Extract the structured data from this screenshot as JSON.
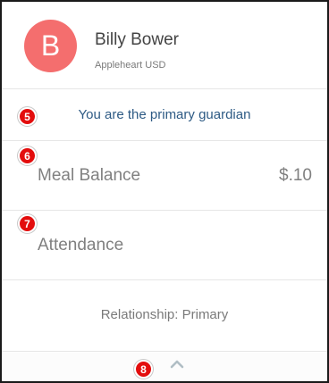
{
  "colors": {
    "avatar_bg": "#f46e6e",
    "marker_bg": "#e30d0d",
    "accent_text": "#2d5a84",
    "chevron": "#b0bec5"
  },
  "profile": {
    "avatar_letter": "B",
    "name": "Billy Bower",
    "district": "Appleheart USD"
  },
  "guardian_note": "You are the primary guardian",
  "meal_balance": {
    "label": "Meal Balance",
    "value": "$.10"
  },
  "attendance": {
    "label": "Attendance"
  },
  "relationship_text": "Relationship: Primary",
  "markers": [
    "5",
    "6",
    "7",
    "8"
  ],
  "icons": {
    "collapse": "chevron-up-icon"
  }
}
